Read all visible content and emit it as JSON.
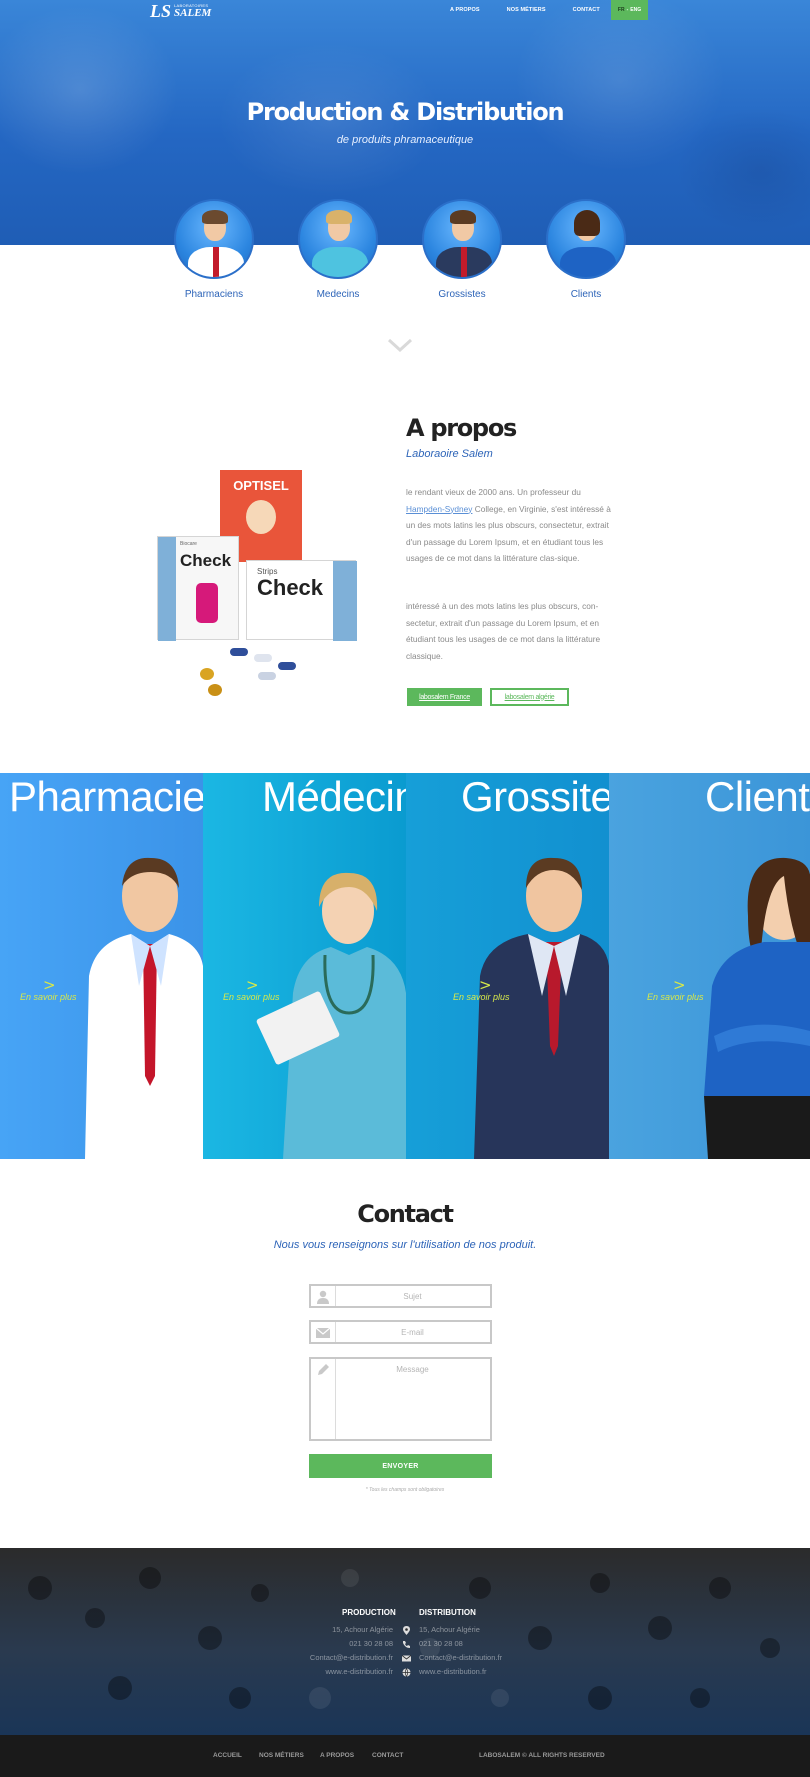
{
  "header": {
    "logo_mark": "LS",
    "logo_top": "LABORATOIRES",
    "logo_bottom": "SALEM",
    "nav": [
      "A PROPOS",
      "NOS MÉTIERS",
      "CONTACT"
    ],
    "lang_fr": "FR",
    "lang_sep": "-",
    "lang_eng": "ENG"
  },
  "hero": {
    "title": "Production & Distribution",
    "subtitle": "de produits phramaceutique"
  },
  "categories": [
    "Pharmaciens",
    "Medecins",
    "Grossistes",
    "Clients"
  ],
  "about": {
    "title": "A propos",
    "subtitle": "Laboraoire Salem",
    "p1_before": "le rendant vieux de 2000 ans. Un professeur du",
    "p1_link": "Hampden-Sydney",
    "p1_after": "College, en Virginie, s'est intéressé à un des mots latins les plus obscurs, consectetur, extrait d'un passage du Lorem Ipsum, et en étudiant tous les usages de ce mot dans la littérature clas-sique.",
    "p2": "intéressé à un des mots latins les plus obscurs, con-sectetur, extrait d'un passage du Lorem Ipsum, et en étudiant tous les usages de ce mot dans la littérature classique.",
    "btn_fr": "labosalem France",
    "btn_dz": "labosalem algérie",
    "products": {
      "optisel": "OPTISEL",
      "check": "Check",
      "check_brand": "Biocare",
      "strips": "Strips",
      "strips_check": "Check"
    }
  },
  "panels": [
    {
      "title": "Pharmaciens",
      "arrow": ">",
      "more": "En savoir plus"
    },
    {
      "title": "Médecins",
      "arrow": ">",
      "more": "En savoir plus"
    },
    {
      "title": "Grossites",
      "arrow": ">",
      "more": "En savoir plus"
    },
    {
      "title": "Clients",
      "arrow": ">",
      "more": "En savoir plus"
    }
  ],
  "contact": {
    "title": "Contact",
    "subtitle": "Nous vous renseignons sur l'utilisation de nos produit.",
    "subject_placeholder": "Sujet",
    "email_placeholder": "E-mail",
    "message_placeholder": "Message",
    "send": "ENVOYER",
    "required_note": "* Tous les champs sont obligatoires"
  },
  "footer": {
    "production": {
      "title": "PRODUCTION",
      "address": "15, Achour Algérie",
      "phone": "021 30 28 08",
      "email": "Contact@e-distribution.fr",
      "web": "www.e-distribution.fr"
    },
    "distribution": {
      "title": "DISTRIBUTION",
      "address": "15, Achour Algérie",
      "phone": "021 30 28 08",
      "email": "Contact@e-distribution.fr",
      "web": "www.e-distribution.fr"
    },
    "bottom_nav": [
      "ACCUEIL",
      "NOS MÉTIERS",
      "A PROPOS",
      "CONTACT"
    ],
    "copyright": "LABOSALEM © ALL RIGHTS RESERVED"
  }
}
